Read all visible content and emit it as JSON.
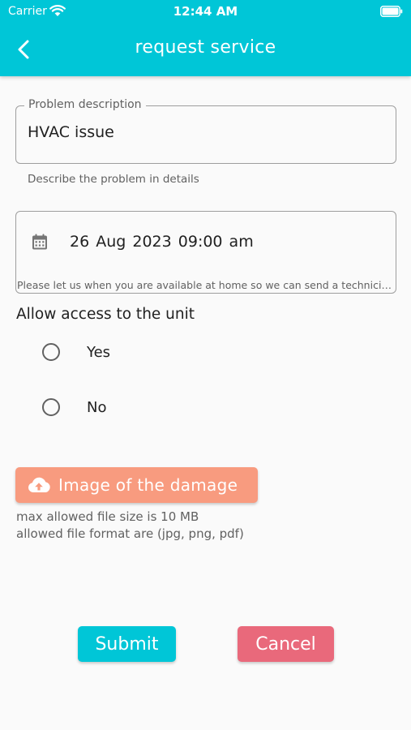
{
  "status_bar": {
    "carrier": "Carrier",
    "time": "12:44 AM",
    "wifi_icon": "wifi-icon",
    "battery_icon": "battery-icon"
  },
  "header": {
    "title": "request service",
    "back_icon": "chevron-left-icon",
    "background_color": "#00c6d7"
  },
  "problem_field": {
    "label": "Problem description",
    "value": "HVAC issue",
    "helper": "Describe the problem in details"
  },
  "availability_field": {
    "icon": "calendar-icon",
    "date": "26 Aug 2023",
    "time": "09:00 am",
    "hint": "Please let us when you are available at home so we can send a technician"
  },
  "access": {
    "title": "Allow access to the unit",
    "options": [
      {
        "label": "Yes",
        "selected": false
      },
      {
        "label": "No",
        "selected": false
      }
    ]
  },
  "upload": {
    "icon": "cloud-upload-icon",
    "label": "Image of the damage",
    "max_size_note": "max allowed file size is 10 MB",
    "format_note": "allowed file format are (jpg, png, pdf)",
    "color": "#f89b7f"
  },
  "actions": {
    "submit_label": "Submit",
    "cancel_label": "Cancel",
    "submit_color": "#00c6d7",
    "cancel_color": "#e9697b"
  }
}
